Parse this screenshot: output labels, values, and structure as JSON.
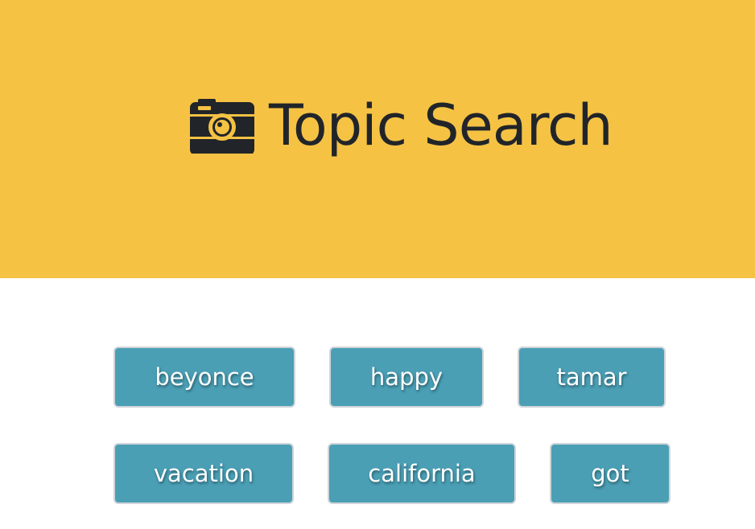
{
  "header": {
    "title": "Topic Search",
    "icon": "camera-icon",
    "background_color": "#f5c244"
  },
  "topics": [
    {
      "label": "beyonce"
    },
    {
      "label": "happy"
    },
    {
      "label": "tamar"
    },
    {
      "label": "vacation"
    },
    {
      "label": "california"
    },
    {
      "label": "got"
    }
  ],
  "button_color": "#4a9fb5"
}
